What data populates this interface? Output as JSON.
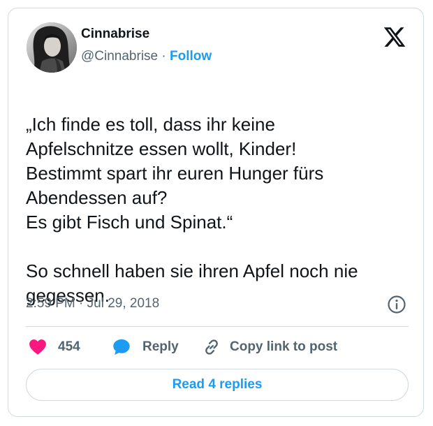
{
  "author": {
    "name": "Cinnabrise",
    "handle": "@Cinnabrise",
    "separator": "·",
    "follow_label": "Follow"
  },
  "tweet": {
    "paragraph1": "„Ich finde es toll, dass ihr keine\nApfelschnitze essen wollt, Kinder!\nBestimmt spart ihr euren Hunger fürs\nAbendessen auf?\nEs gibt Fisch und Spinat.“",
    "paragraph2": "So schnell haben sie ihren Apfel noch nie\ngegessen.",
    "timestamp": "2:59 PM · Jul 29, 2018"
  },
  "actions": {
    "like_count": "454",
    "reply_label": "Reply",
    "copy_link_label": "Copy link to post"
  },
  "footer": {
    "read_replies_label": "Read 4 replies"
  },
  "icons": {
    "logo": "x-logo-icon",
    "info": "info-icon",
    "like": "heart-icon",
    "reply": "speech-bubble-icon",
    "copy": "link-icon"
  },
  "colors": {
    "accent": "#1d9bf0",
    "like": "#f91880",
    "secondary_text": "#536471",
    "border": "#cfd9de"
  }
}
